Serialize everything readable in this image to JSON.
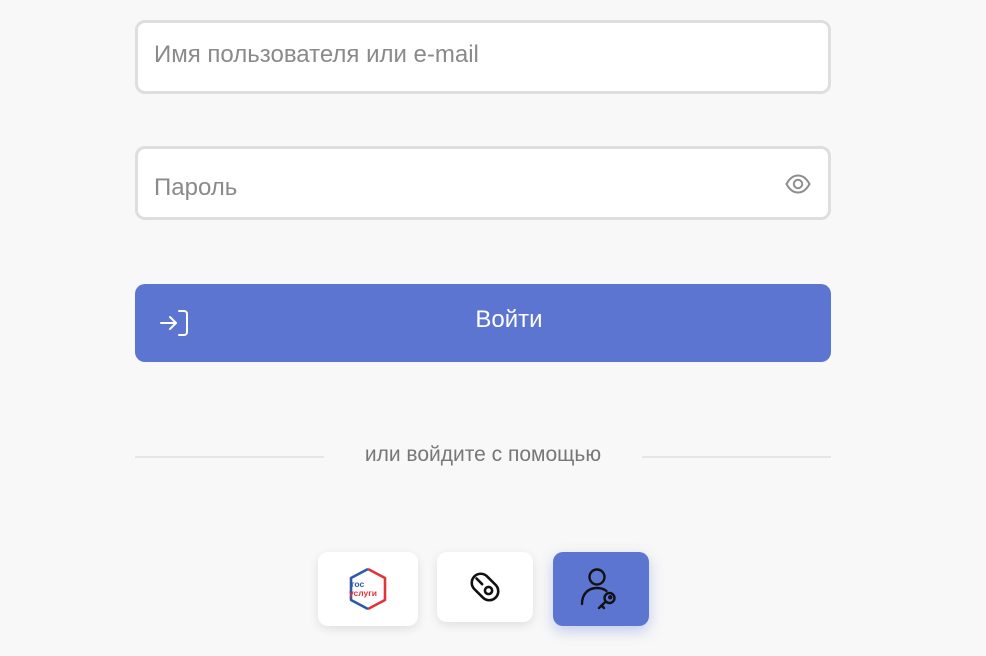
{
  "form": {
    "username_placeholder": "Имя пользователя или e-mail",
    "password_placeholder": "Пароль",
    "password_toggle_icon": "eye-icon",
    "login_label": "Войти",
    "login_icon": "sign-in-icon"
  },
  "divider": {
    "label": "или войдите с помощью"
  },
  "alt_methods": {
    "gosuslugi": {
      "logo_text_line1": "гос",
      "logo_text_line2": "услуги"
    },
    "token_icon": "usb-token-icon",
    "user_key_icon": "user-key-icon"
  },
  "colors": {
    "accent": "#5b75d1",
    "background": "#f8f8f8",
    "field_border": "#dedede",
    "gos_blue": "#2d5aa8",
    "gos_red": "#e0343b"
  }
}
